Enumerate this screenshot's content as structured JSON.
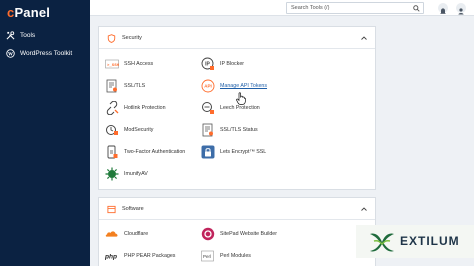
{
  "sidebar": {
    "logo": "cPanel",
    "items": [
      {
        "label": "Tools",
        "icon": "wrench-screwdriver-icon"
      },
      {
        "label": "WordPress Toolkit",
        "icon": "wordpress-icon"
      }
    ]
  },
  "topbar": {
    "search_placeholder": "Search Tools (/)"
  },
  "security": {
    "title": "Security",
    "items": [
      {
        "label": "SSH Access",
        "icon": "ssh-terminal-icon"
      },
      {
        "label": "IP Blocker",
        "icon": "ip-blocker-icon"
      },
      {
        "label": "SSL/TLS",
        "icon": "ssl-certificate-icon"
      },
      {
        "label": "Manage API Tokens",
        "icon": "api-token-icon"
      },
      {
        "label": "Hotlink Protection",
        "icon": "hotlink-protection-icon"
      },
      {
        "label": "Leech Protection",
        "icon": "leech-protection-icon"
      },
      {
        "label": "ModSecurity",
        "icon": "modsecurity-icon"
      },
      {
        "label": "SSL/TLS Status",
        "icon": "ssl-status-icon"
      },
      {
        "label": "Two-Factor Authentication",
        "icon": "two-factor-icon"
      },
      {
        "label": "Lets Encrypt™ SSL",
        "icon": "lets-encrypt-icon"
      },
      {
        "label": "ImunifyAV",
        "icon": "imunifyav-icon"
      }
    ]
  },
  "software": {
    "title": "Software",
    "items": [
      {
        "label": "Cloudflare",
        "icon": "cloudflare-icon"
      },
      {
        "label": "SitePad Website Builder",
        "icon": "sitepad-icon"
      },
      {
        "label": "PHP PEAR Packages",
        "icon": "php-icon"
      },
      {
        "label": "Perl Modules",
        "icon": "perl-icon"
      }
    ]
  },
  "watermark": {
    "brand": "EXTILUM"
  },
  "colors": {
    "sidebar_bg": "#0b2242",
    "accent_orange": "#ff6c2c",
    "link_blue": "#1f5fa8"
  }
}
